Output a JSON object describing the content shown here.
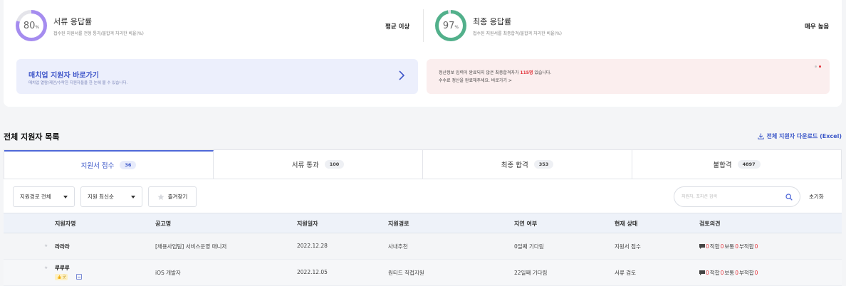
{
  "stats": [
    {
      "value": "80",
      "unit": "%",
      "title": "서류 응답률",
      "desc": "접수된 지원서를 전형 통과/불합격 처리한 비율(%)",
      "level": "평균 이상",
      "color": "#a58cef"
    },
    {
      "value": "97",
      "unit": "%",
      "title": "최종 응답률",
      "desc": "접수된 지원서를 최종합격/불합격 처리한 비율(%)",
      "level": "매우 높음",
      "color": "#52b08b"
    }
  ],
  "match_banner": {
    "title": "매치업 지원자 바로가기",
    "desc": "매치업 열람/제안/수락한 지원자들을 한 눈에 볼 수 있습니다."
  },
  "notice_banner": {
    "line1_pre": "정산정보 입력이 완료되지 않은 최종합격자가 ",
    "line1_highlight": "115명",
    "line1_post": " 있습니다.",
    "line2": "수수료 정산을 완료해주세요.  바로가기 >"
  },
  "section": {
    "title": "전체 지원자 목록",
    "download": "전체 지원자 다운로드 (Excel)"
  },
  "tabs": [
    {
      "label": "지원서 접수",
      "count": "36"
    },
    {
      "label": "서류 통과",
      "count": "100"
    },
    {
      "label": "최종 합격",
      "count": "353"
    },
    {
      "label": "불합격",
      "count": "4897"
    }
  ],
  "filters": {
    "route": "지원경로 전체",
    "sort": "지원 최신순",
    "favorites": "즐겨찾기",
    "search_placeholder": "지원자, 포지션 검색",
    "reset": "초기화"
  },
  "table": {
    "headers": [
      "지원자명",
      "공고명",
      "지원일자",
      "지원경로",
      "지연 여부",
      "현재 상태",
      "검토의견"
    ],
    "rows": [
      {
        "name": "라라라",
        "posting": "[채용사업팀] 서비스운영 매니저",
        "date": "2022.12.28",
        "route": "사내추천",
        "delay": "0일째 기다림",
        "status": "지원서 접수",
        "badge": ""
      },
      {
        "name": "루루루",
        "posting": "iOS 개발자",
        "date": "2022.12.05",
        "route": "원티드 직접지원",
        "delay": "22일째 기다림",
        "status": "서류 검토",
        "badge": "👍 굿"
      }
    ],
    "review": {
      "a_label": "적합",
      "a_value": "0",
      "b_label": "보통",
      "b_value": "0",
      "c_label": "부적합",
      "c_value": "0"
    }
  }
}
